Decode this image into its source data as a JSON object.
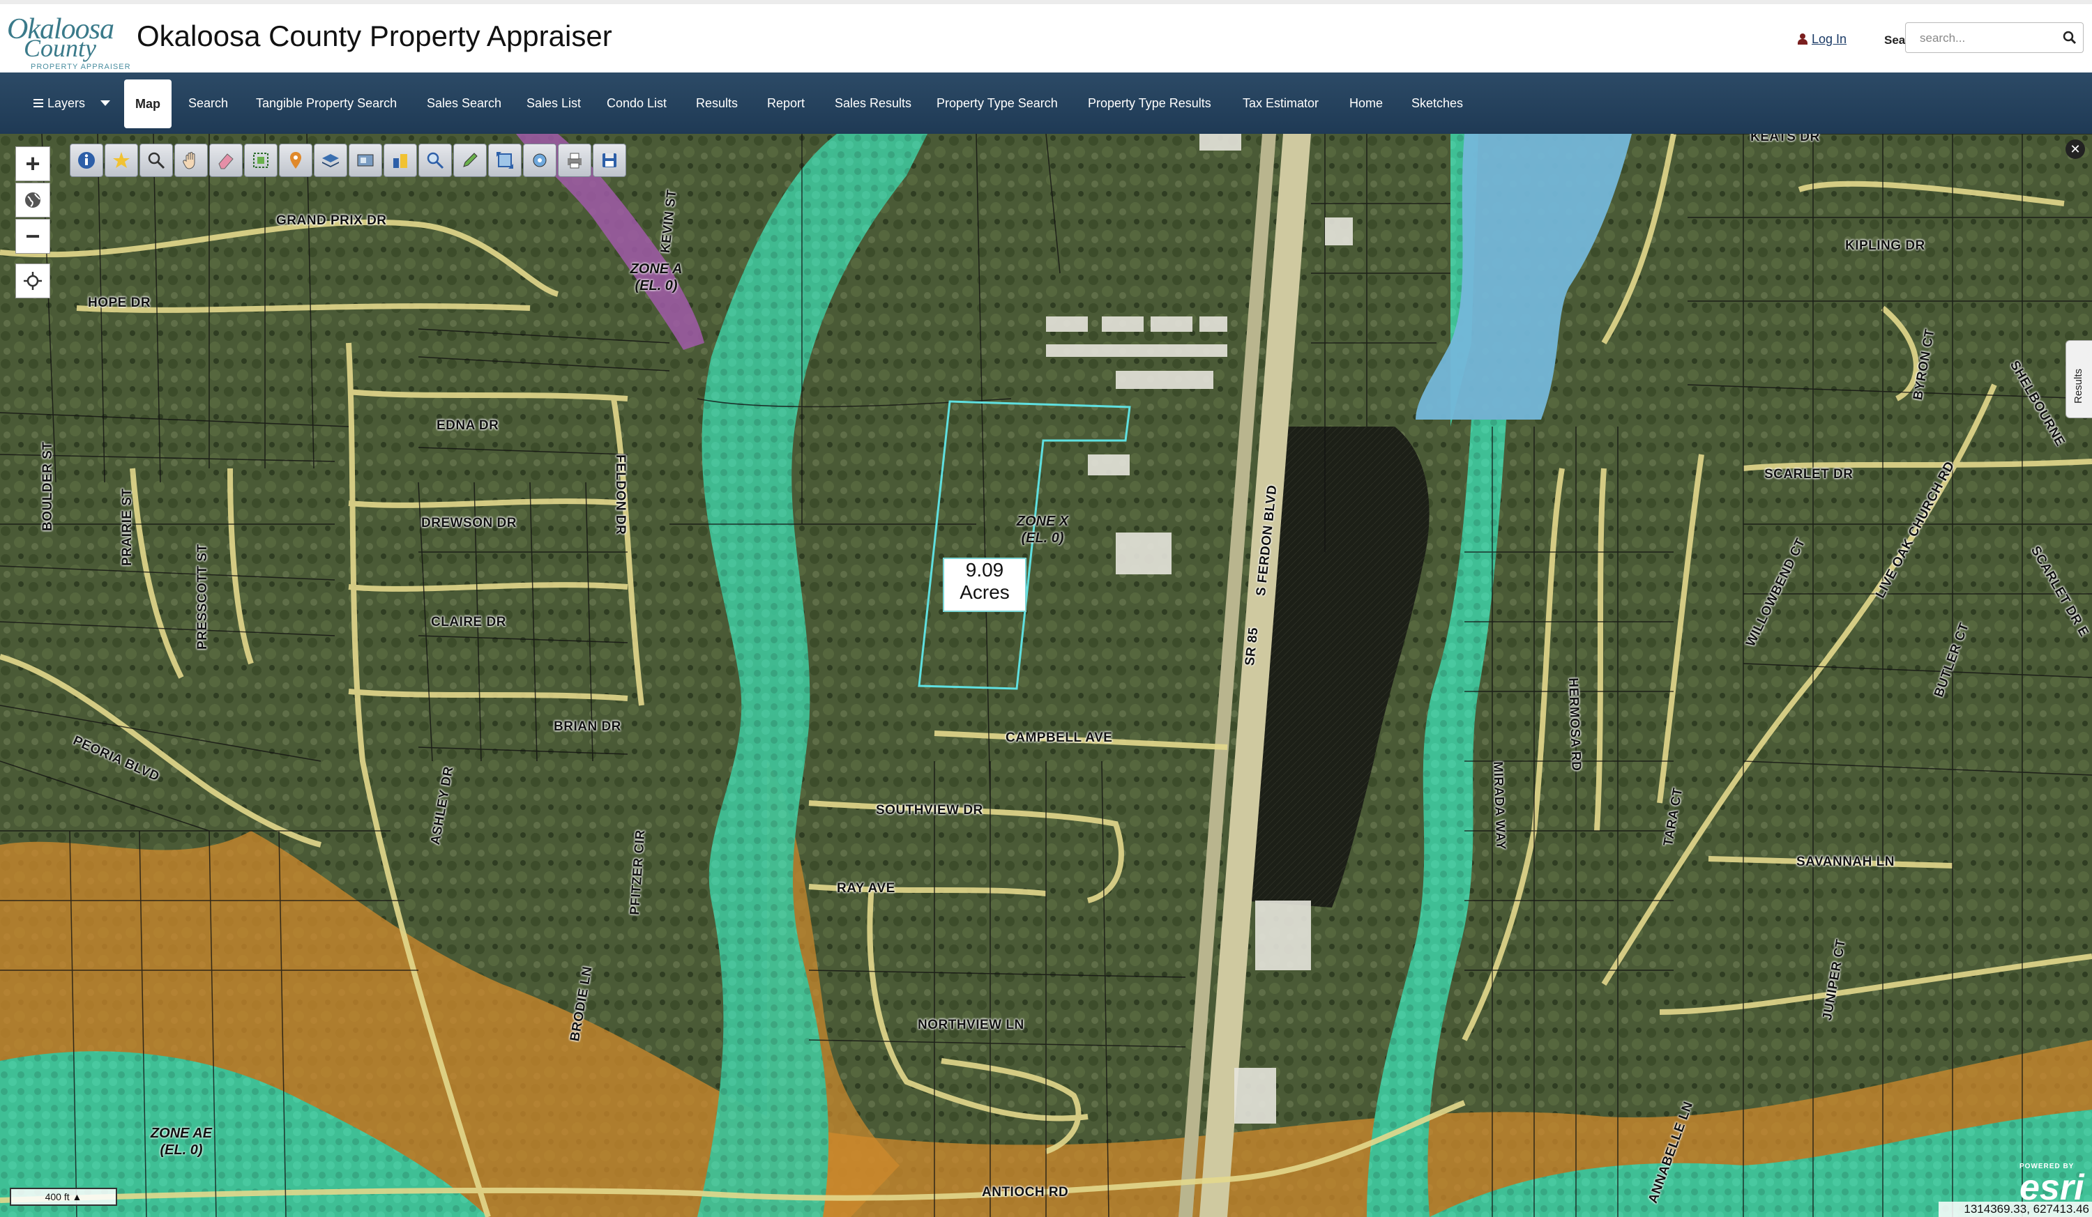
{
  "header": {
    "logo_line1": "Okaloosa",
    "logo_line2": "County",
    "logo_line3": "PROPERTY APPRAISER",
    "title": "Okaloosa County Property Appraiser",
    "login_label": "Log In",
    "search_label": "Search",
    "search_placeholder": "search..."
  },
  "nav": {
    "items": [
      {
        "label": "Layers"
      },
      {
        "label": "Map",
        "active": true
      },
      {
        "label": "Search"
      },
      {
        "label": "Tangible Property Search"
      },
      {
        "label": "Sales Search"
      },
      {
        "label": "Sales List"
      },
      {
        "label": "Condo List"
      },
      {
        "label": "Results"
      },
      {
        "label": "Report"
      },
      {
        "label": "Sales Results"
      },
      {
        "label": "Property Type Search"
      },
      {
        "label": "Property Type Results"
      },
      {
        "label": "Tax Estimator"
      },
      {
        "label": "Home"
      },
      {
        "label": "Sketches"
      }
    ]
  },
  "map": {
    "zoom_in": "+",
    "zoom_out": "−",
    "toolbar_icons": [
      "info-icon",
      "identify-icon",
      "zoom-select-icon",
      "pan-icon",
      "erase-icon",
      "select-icon",
      "marker-icon",
      "layers-tool-icon",
      "map-swap-icon",
      "buildings-icon",
      "magnify-icon",
      "draw-icon",
      "extent-icon",
      "locate-tool-icon",
      "print-icon",
      "save-icon"
    ],
    "parcel": {
      "acreage_value": "9.09",
      "acreage_unit": "Acres"
    },
    "streets": [
      "GRAND PRIX DR",
      "HOPE DR",
      "EDNA DR",
      "DREWSON DR",
      "CLAIRE DR",
      "BRIAN DR",
      "PEORIA BLVD",
      "BOULDER ST",
      "PRAIRIE ST",
      "PRESSCOTT ST",
      "FELDON DR",
      "ASHLEY DR",
      "CAMPBELL AVE",
      "SOUTHVIEW DR",
      "RAY AVE",
      "NORTHVIEW LN",
      "ANTIOCH RD",
      "S FERDON BLVD",
      "SR 85",
      "KIPLING DR",
      "SCARLET DR",
      "MIRADA WAY",
      "HERMOSA RD",
      "TARA CT",
      "SAVANNAH LN",
      "BUTLER CT",
      "WILLOWBEND CT",
      "LIVE OAK CHURCH RD",
      "JUNIPER CT",
      "BYRON CT",
      "BRODIE LN",
      "PFITZER CIR",
      "ANNABELLE LN",
      "KEATS DR",
      "KEVIN ST",
      "SHELBOURNE",
      "SCARLET DR E"
    ],
    "zones": [
      {
        "line1": "ZONE A",
        "line2": "(EL. 0)"
      },
      {
        "line1": "ZONE X",
        "line2": "(EL. 0)"
      },
      {
        "line1": "ZONE AE",
        "line2": "(EL. 0)"
      }
    ],
    "results_tab": "Results",
    "scale_label": "400 ft",
    "esri_powered": "POWERED BY",
    "esri_mark": "esri",
    "coordinates": "1314369.33, 627413.46"
  },
  "colors": {
    "nav_bg": "#24425e",
    "floodplain": "#3fbf95",
    "zone_orange": "#d08a2c",
    "parcel_outline": "#5fe0e0",
    "water": "#74b7d9"
  }
}
